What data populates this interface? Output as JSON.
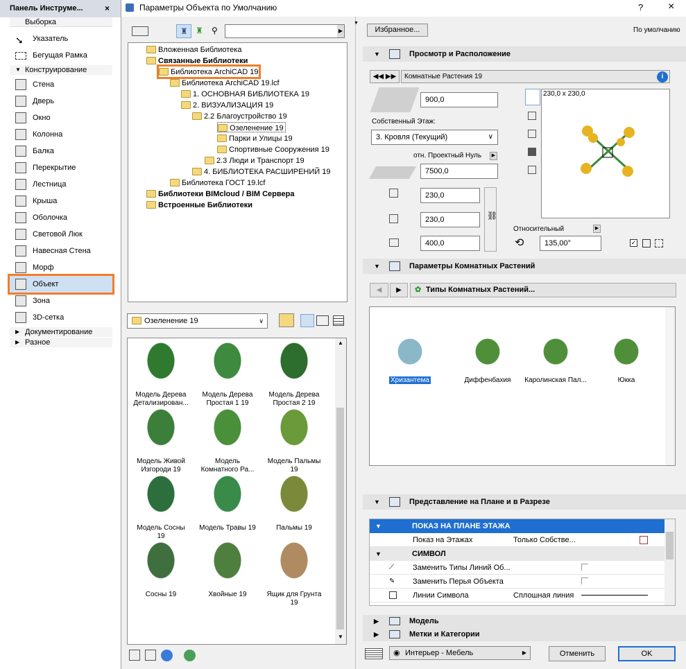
{
  "palette": {
    "title": "Панель Инструме...",
    "close": "×",
    "select_label": "Выборка",
    "tools_basic": [
      "Указатель",
      "Бегущая Рамка"
    ],
    "construct_label": "Конструирование",
    "tools": [
      "Стена",
      "Дверь",
      "Окно",
      "Колонна",
      "Балка",
      "Перекрытие",
      "Лестница",
      "Крыша",
      "Оболочка",
      "Световой Люк",
      "Навесная Стена",
      "Морф",
      "Объект",
      "Зона",
      "3D-сетка"
    ],
    "selected_tool": "Объект",
    "doc_label": "Документирование",
    "misc_label": "Разное"
  },
  "dialog": {
    "title": "Параметры Объекта по Умолчанию",
    "help": "?",
    "close": "×"
  },
  "library_tree": {
    "items": [
      "Вложенная Библиотека",
      "Связанные Библиотеки",
      "Библиотека ArchiCAD 19",
      "Библиотека ArchiCAD 19.lcf",
      "1. ОСНОВНАЯ БИБЛИОТЕКА 19",
      "2. ВИЗУАЛИЗАЦИЯ 19",
      "2.2 Благоустройство 19",
      "Озеленение 19",
      "Парки и Улицы 19",
      "Спортивные Сооружения 19",
      "2.3 Люди и Транспорт 19",
      "4. БИБЛИОТЕКА РАСШИРЕНИЙ 19",
      "Библиотека ГОСТ 19.lcf",
      "Библиотеки BIMcloud / BIM Сервера",
      "Встроенные Библиотеки"
    ]
  },
  "folder_select": {
    "value": "Озеленение 19"
  },
  "objects": [
    {
      "l1": "Модель Дерева",
      "l2": "Детализирован..."
    },
    {
      "l1": "Модель Дерева",
      "l2": "Простая 1 19"
    },
    {
      "l1": "Модель Дерева",
      "l2": "Простая 2 19"
    },
    {
      "l1": "Модель Живой",
      "l2": "Изгороди 19"
    },
    {
      "l1": "Модель",
      "l2": "Комнатного Ра..."
    },
    {
      "l1": "Модель Пальмы",
      "l2": "19"
    },
    {
      "l1": "Модель Сосны",
      "l2": "19"
    },
    {
      "l1": "Модель Травы 19",
      "l2": ""
    },
    {
      "l1": "Пальмы 19",
      "l2": ""
    },
    {
      "l1": "Сосны 19",
      "l2": ""
    },
    {
      "l1": "Хвойные 19",
      "l2": ""
    },
    {
      "l1": "Ящик для Грунта",
      "l2": "19"
    }
  ],
  "right": {
    "favorites": "Избранное...",
    "defaults": "По умолчанию",
    "section1": "Просмотр и Расположение",
    "object_name": "Комнатные Растения 19",
    "info": "i",
    "height": "900,0",
    "story_label": "Собственный Этаж:",
    "story_value": "3. Кровля (Текущий)",
    "zero_label": "отн. Проектный Нуль",
    "elevation": "7500,0",
    "size_a": "230,0",
    "size_b": "230,0",
    "size_c": "400,0",
    "preview_label": "230,0 х 230,0",
    "rel_label": "Относительный",
    "angle": "135,00°",
    "section2": "Параметры Комнатных Растений",
    "plant_types": "Типы Комнатных Растений...",
    "plants": [
      "Хризантема",
      "Диффенбахия",
      "Каролинская Пал...",
      "Юкка"
    ],
    "plant_selected": "Хризантема",
    "section3": "Представление на Плане и в Разрезе",
    "grp1": "ПОКАЗ НА ПЛАНЕ ЭТАЖА",
    "row1_label": "Показ на Этажах",
    "row1_value": "Только Собстве...",
    "grp2": "СИМВОЛ",
    "row2_label": "Заменить Типы Линий Об...",
    "row3_label": "Заменить Перья Объекта",
    "row4_label": "Линии Символа",
    "row4_value": "Сплошная линия",
    "section4": "Модель",
    "section5": "Метки и Категории",
    "layer": "Интерьер - Мебель",
    "cancel": "Отменить",
    "ok": "OK"
  },
  "colors": {
    "accent": "#f07e2a",
    "selection": "#1e6fd1",
    "header": "#e3e3e3"
  }
}
